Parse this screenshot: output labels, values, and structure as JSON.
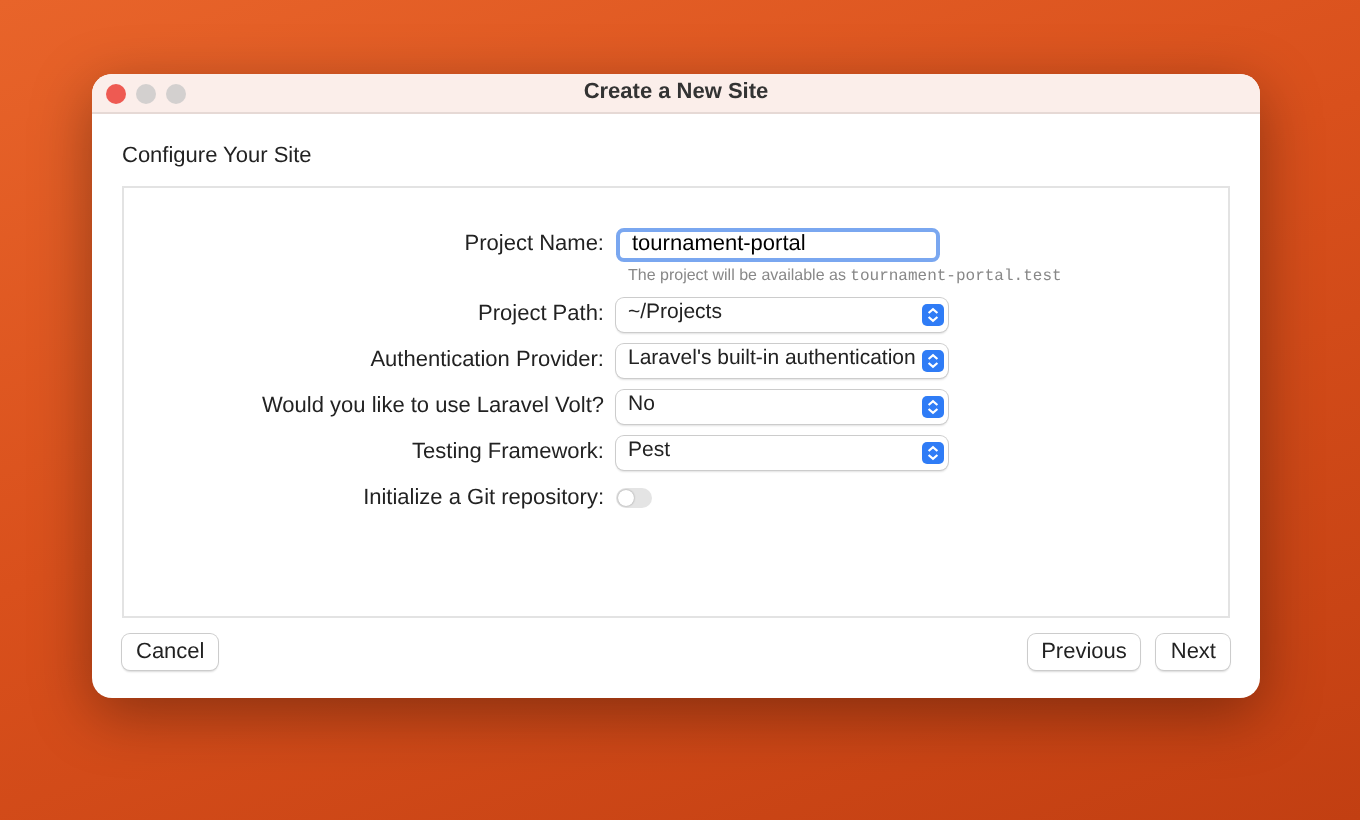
{
  "window": {
    "title": "Create a New Site"
  },
  "section_title": "Configure Your Site",
  "fields": [
    {
      "kind": "text",
      "label": "Project Name:",
      "value": "tournament-portal",
      "hint": "The project will be available as ",
      "hint_code": "tournament-portal.test"
    },
    {
      "kind": "select",
      "label": "Project Path:",
      "value": "~/Projects"
    },
    {
      "kind": "select",
      "label": "Authentication Provider:",
      "value": "Laravel's built-in authentication"
    },
    {
      "kind": "select",
      "label": "Would you like to use Laravel Volt?",
      "value": "No"
    },
    {
      "kind": "select",
      "label": "Testing Framework:",
      "value": "Pest"
    },
    {
      "kind": "toggle",
      "label": "Initialize a Git repository:",
      "on": false
    }
  ],
  "buttons_left": [
    "Cancel"
  ],
  "buttons_right": [
    "Previous",
    "Next"
  ]
}
